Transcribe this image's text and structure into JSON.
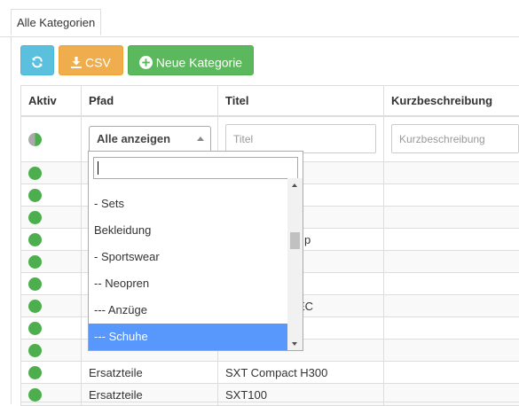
{
  "tabs": {
    "active_label": "Alle Kategorien"
  },
  "toolbar": {
    "refresh_icon": "refresh-icon",
    "csv_label": "CSV",
    "csv_icon": "download-icon",
    "new_label": "Neue Kategorie",
    "new_icon": "plus-circle-icon",
    "colors": {
      "info": "#5bc0de",
      "warning": "#f0ad4e",
      "success": "#5cb85c"
    }
  },
  "table": {
    "headers": {
      "aktiv": "Aktiv",
      "pfad": "Pfad",
      "titel": "Titel",
      "kurz": "Kurzbeschreibung"
    },
    "filter": {
      "pfad_selected": "Alle anzeigen",
      "titel_placeholder": "Titel",
      "kurz_placeholder": "Kurzbeschreibung"
    },
    "rows": [
      {
        "pfad": "",
        "titel": ""
      },
      {
        "pfad": "",
        "titel": ""
      },
      {
        "pfad": "",
        "titel": ""
      },
      {
        "pfad": "",
        "titel": "p"
      },
      {
        "pfad": "",
        "titel": ""
      },
      {
        "pfad": "",
        "titel": ""
      },
      {
        "pfad": "",
        "titel": "EC"
      },
      {
        "pfad": "",
        "titel": ""
      },
      {
        "pfad": "",
        "titel": ""
      },
      {
        "pfad": "Ersatzteile",
        "titel": "SXT Compact H300"
      },
      {
        "pfad": "Ersatzteile",
        "titel": "SXT100"
      }
    ]
  },
  "dropdown": {
    "search_value": "",
    "items": [
      "- Sets",
      "Bekleidung",
      "- Sportswear",
      "-- Neopren",
      "--- Anzüge",
      "--- Schuhe"
    ],
    "selected_index": 5
  }
}
